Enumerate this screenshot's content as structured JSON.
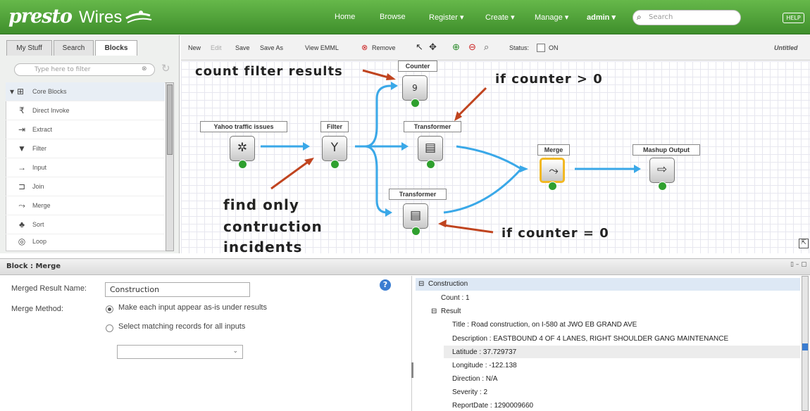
{
  "header": {
    "logo_main": "presto",
    "logo_sub": "Wires",
    "nav": [
      "Home",
      "Browse",
      "Register ▾",
      "Create ▾",
      "Manage ▾"
    ],
    "user": "admin ▾",
    "search_placeholder": "Search",
    "help": "HELP"
  },
  "left": {
    "tabs": [
      "My Stuff",
      "Search",
      "Blocks"
    ],
    "filter_placeholder": "Type here to filter",
    "group": "Core Blocks",
    "items": [
      {
        "icon": "direct-invoke-icon",
        "label": "Direct Invoke"
      },
      {
        "icon": "extract-icon",
        "label": "Extract"
      },
      {
        "icon": "filter-icon",
        "label": "Filter"
      },
      {
        "icon": "input-icon",
        "label": "Input"
      },
      {
        "icon": "join-icon",
        "label": "Join"
      },
      {
        "icon": "merge-icon",
        "label": "Merge"
      },
      {
        "icon": "sort-icon",
        "label": "Sort"
      },
      {
        "icon": "loop-icon",
        "label": "Loop"
      }
    ]
  },
  "toolbar": {
    "new": "New",
    "edit": "Edit",
    "save": "Save",
    "save_as": "Save As",
    "view_emml": "View EMML",
    "remove": "Remove",
    "status": "Status:",
    "on": "ON",
    "title": "Untitled"
  },
  "canvas": {
    "blocks": [
      "Yahoo traffic issues",
      "Filter",
      "Counter",
      "Transformer",
      "Transformer",
      "Merge",
      "Mashup Output"
    ],
    "counter_value": "9",
    "annotations": {
      "count": "count filter results",
      "gt": "if counter > 0",
      "find1": "find only",
      "find2": "contruction",
      "find3": "incidents",
      "eq": "if counter = 0"
    }
  },
  "panel": {
    "title": "Block : Merge",
    "merged_name_label": "Merged Result Name:",
    "merged_name_value": "Construction",
    "merge_method_label": "Merge Method:",
    "option1": "Make each input appear as-is under results",
    "option2": "Select matching records for all inputs"
  },
  "tree": {
    "root": "Construction",
    "count": "Count : 1",
    "result": "Result",
    "title": "Title : Road construction, on I-580 at JWO EB GRAND AVE",
    "description": "Description : EASTBOUND 4 OF 4 LANES, RIGHT SHOULDER GANG MAINTENANCE",
    "latitude": "Latitude : 37.729737",
    "longitude": "Longitude : -122.138",
    "direction": "Direction : N/A",
    "severity": "Severity : 2",
    "reportdate": "ReportDate : 1290009660"
  }
}
